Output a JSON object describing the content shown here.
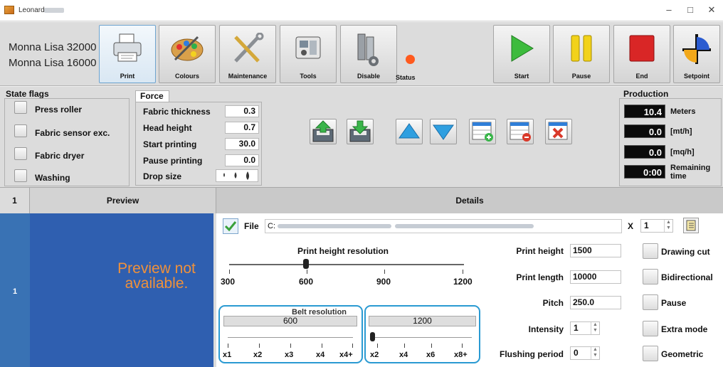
{
  "window": {
    "title": "Leonardo",
    "minimize": "–",
    "maximize": "□",
    "close": "✕"
  },
  "toolbar": {
    "machines": [
      "Monna Lisa 32000",
      "Monna Lisa 16000"
    ],
    "buttons": [
      "Print",
      "Colours",
      "Maintenance",
      "Tools",
      "Disable"
    ],
    "status_label": "Status",
    "status_color": "#ff5a1e",
    "control_buttons": [
      "Start",
      "Pause",
      "End",
      "Setpoint"
    ]
  },
  "state_flags": {
    "title": "State flags",
    "items": [
      "Press roller",
      "Fabric sensor exc.",
      "Fabric dryer",
      "Washing"
    ]
  },
  "force": {
    "title": "Force",
    "rows": [
      {
        "label": "Fabric thickness",
        "value": "0.3"
      },
      {
        "label": "Head height",
        "value": "0.7"
      },
      {
        "label": "Start printing",
        "value": "30.0"
      },
      {
        "label": "Pause printing",
        "value": "0.0"
      }
    ],
    "drop_size_label": "Drop size"
  },
  "production": {
    "title": "Production",
    "rows": [
      {
        "value": "10.4",
        "label": "Meters"
      },
      {
        "value": "0.0",
        "label": "[mt/h]"
      },
      {
        "value": "0.0",
        "label": "[mq/h]"
      },
      {
        "value": "0:00",
        "label": "Remaining time"
      }
    ]
  },
  "table_header": {
    "number": "1",
    "preview": "Preview",
    "details": "Details"
  },
  "row": {
    "number": "1",
    "preview_text": "Preview not available."
  },
  "details": {
    "file_label": "File",
    "file_path": "C:",
    "copies_label": "X",
    "copies_value": "1",
    "print_height_res": {
      "title": "Print height resolution",
      "ticks": [
        "300",
        "600",
        "900",
        "1200"
      ],
      "selected": "600"
    },
    "belt_res": {
      "title": "Belt resolution",
      "value": "600",
      "ticks": [
        "x1",
        "x2",
        "x3",
        "x4",
        "x4+"
      ]
    },
    "second_res": {
      "value": "1200",
      "ticks": [
        "x2",
        "x4",
        "x6",
        "x8+"
      ]
    },
    "fields": [
      {
        "label": "Print height",
        "value": "1500"
      },
      {
        "label": "Print length",
        "value": "10000"
      },
      {
        "label": "Pitch",
        "value": "250.0"
      },
      {
        "label": "Intensity",
        "value": "1"
      },
      {
        "label": "Flushing period",
        "value": "0"
      }
    ],
    "options": [
      "Drawing cut",
      "Bidirectional",
      "Pause",
      "Extra mode",
      "Geometric"
    ]
  }
}
